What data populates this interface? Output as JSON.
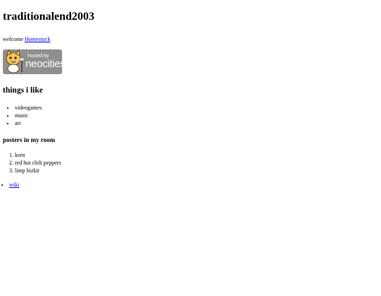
{
  "page": {
    "title": "traditionalend2003",
    "welcome_text": "welcome",
    "welcome_link": "Homestuck"
  },
  "badge": {
    "hosted_by": "hosted by",
    "brand": "neocities",
    "icon": "neocities-cat-icon"
  },
  "likes": {
    "heading": "things i like",
    "items": [
      "videogames",
      "music",
      "art"
    ]
  },
  "posters": {
    "heading": "posters in my room",
    "items": [
      "korn",
      "red hot chili peppers",
      "limp bizkit"
    ]
  },
  "links": [
    {
      "label": "wiki"
    }
  ]
}
